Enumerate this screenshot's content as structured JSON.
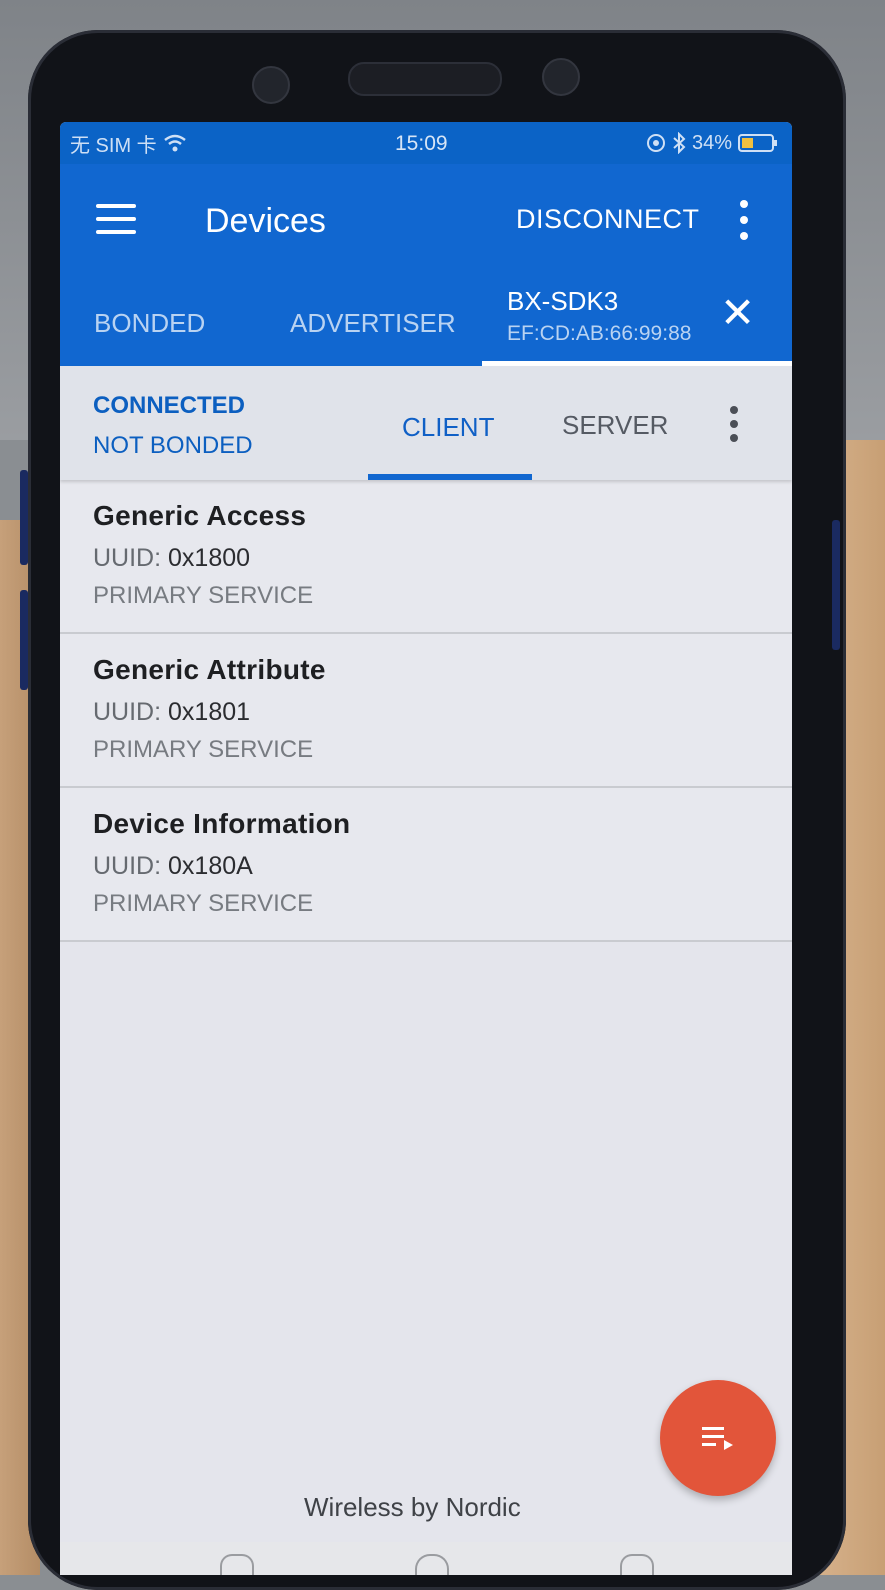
{
  "status_bar": {
    "carrier": "无 SIM 卡",
    "time": "15:09",
    "battery": "34%"
  },
  "appbar": {
    "title": "Devices",
    "disconnect_label": "DISCONNECT"
  },
  "tabs": {
    "bonded": "BONDED",
    "advertiser": "ADVERTISER",
    "device_name": "BX-SDK3",
    "device_address": "EF:CD:AB:66:99:88"
  },
  "connection": {
    "state": "CONNECTED",
    "bond": "NOT BONDED",
    "client_tab": "CLIENT",
    "server_tab": "SERVER"
  },
  "services": [
    {
      "name": "Generic Access",
      "uuid_label": "UUID:",
      "uuid": "0x1800",
      "type": "PRIMARY SERVICE"
    },
    {
      "name": "Generic Attribute",
      "uuid_label": "UUID:",
      "uuid": "0x1801",
      "type": "PRIMARY SERVICE"
    },
    {
      "name": "Device Information",
      "uuid_label": "UUID:",
      "uuid": "0x180A",
      "type": "PRIMARY SERVICE"
    }
  ],
  "footer": {
    "brand": "Wireless by Nordic"
  },
  "colors": {
    "primary": "#1167d0",
    "accent_fab": "#e2553a",
    "connected_text": "#0c5fc0"
  }
}
